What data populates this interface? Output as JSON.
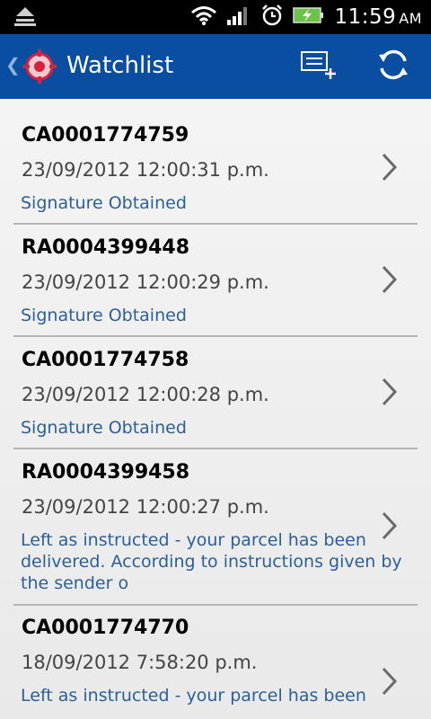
{
  "status_bar": {
    "time": "11:59",
    "ampm": "AM",
    "icons": [
      "notification-icon",
      "wifi-icon",
      "signal-icon",
      "alarm-icon",
      "battery-charging-icon"
    ]
  },
  "action_bar": {
    "title": "Watchlist",
    "icons": [
      "back-chevron-icon",
      "target-logo-icon",
      "add-to-list-icon",
      "refresh-icon"
    ]
  },
  "items": [
    {
      "id": "CA0001774759",
      "datetime": "23/09/2012 12:00:31 p.m.",
      "status": "Signature Obtained"
    },
    {
      "id": "RA0004399448",
      "datetime": "23/09/2012 12:00:29 p.m.",
      "status": "Signature Obtained"
    },
    {
      "id": "CA0001774758",
      "datetime": "23/09/2012 12:00:28 p.m.",
      "status": "Signature Obtained"
    },
    {
      "id": "RA0004399458",
      "datetime": "23/09/2012 12:00:27 p.m.",
      "status": "Left as instructed - your parcel has been delivered. According to instructions given by the sender o"
    },
    {
      "id": "CA0001774770",
      "datetime": "18/09/2012 7:58:20 p.m.",
      "status": "Left as instructed - your parcel has been"
    }
  ],
  "colors": {
    "action_bar": "#0a4ea2",
    "status_text": "#2b5f98",
    "battery": "#6cc24a"
  }
}
